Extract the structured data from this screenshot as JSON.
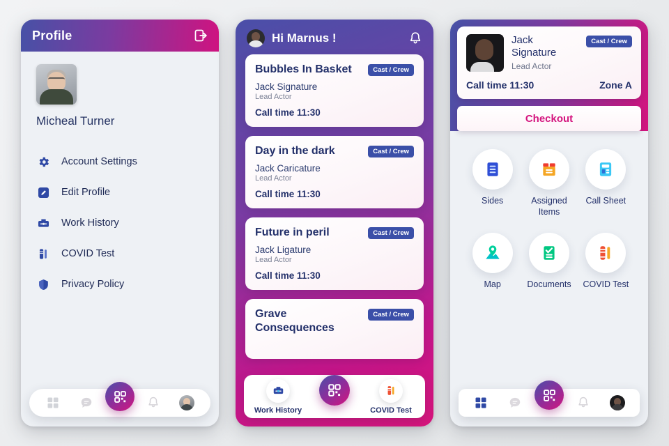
{
  "panel_profile": {
    "header": {
      "title": "Profile",
      "logout_icon": "logout-icon"
    },
    "user": {
      "name": "Micheal Turner",
      "avatar": "user-avatar"
    },
    "menu": [
      {
        "label": "Account Settings",
        "icon": "gear-icon"
      },
      {
        "label": "Edit Profile",
        "icon": "pencil-edit-icon"
      },
      {
        "label": "Work History",
        "icon": "briefcase-icon"
      },
      {
        "label": "COVID Test",
        "icon": "test-tube-icon"
      },
      {
        "label": "Privacy Policy",
        "icon": "shield-icon"
      }
    ],
    "nav": [
      {
        "icon": "grid-icon",
        "active": true
      },
      {
        "icon": "chat-icon",
        "active": false
      },
      {
        "icon": "qr-code-icon",
        "active": false
      },
      {
        "icon": "bell-icon",
        "active": false
      },
      {
        "icon": "profile-avatar-icon",
        "active": false
      }
    ]
  },
  "panel_home": {
    "greeting": "Hi Marnus !",
    "bell_icon": "bell-icon",
    "avatar": "user-avatar",
    "jobs": [
      {
        "title": "Bubbles In Basket",
        "badge": "Cast / Crew",
        "person": "Jack Signature",
        "role": "Lead Actor",
        "call_time": "Call time 11:30"
      },
      {
        "title": "Day in the dark",
        "badge": "Cast / Crew",
        "person": "Jack Caricature",
        "role": "Lead Actor",
        "call_time": "Call time 11:30"
      },
      {
        "title": "Future in peril",
        "badge": "Cast / Crew",
        "person": "Jack Ligature",
        "role": "Lead Actor",
        "call_time": "Call time 11:30"
      },
      {
        "title": "Grave Consequences",
        "badge": "Cast / Crew",
        "person": "",
        "role": "",
        "call_time": ""
      }
    ],
    "nav": [
      {
        "label": "Work History",
        "icon": "briefcase-icon"
      },
      {
        "label": "",
        "icon": "qr-code-icon"
      },
      {
        "label": "COVID Test",
        "icon": "test-tube-icon"
      }
    ]
  },
  "panel_detail": {
    "card": {
      "name": "Jack Signature",
      "role": "Lead Actor",
      "badge": "Cast / Crew",
      "call_time": "Call time 11:30",
      "zone": "Zone A",
      "avatar": "actor-avatar"
    },
    "checkout_label": "Checkout",
    "grid": [
      {
        "label": "Sides",
        "icon": "document-lines-icon",
        "color": "#2f4fd6"
      },
      {
        "label": "Assigned Items",
        "icon": "box-package-icon",
        "color": "#f5a623"
      },
      {
        "label": "Call Sheet",
        "icon": "call-sheet-icon",
        "color": "#3bc8f5"
      },
      {
        "label": "Map",
        "icon": "map-pin-icon",
        "color": "#00d09c"
      },
      {
        "label": "Documents",
        "icon": "checked-document-icon",
        "color": "#00c781"
      },
      {
        "label": "COVID Test",
        "icon": "test-tube-icon",
        "color": "#ef5134"
      }
    ],
    "nav": [
      {
        "icon": "grid-icon",
        "active": true
      },
      {
        "icon": "chat-icon",
        "active": false
      },
      {
        "icon": "qr-code-icon",
        "active": false
      },
      {
        "icon": "bell-icon",
        "active": false
      },
      {
        "icon": "profile-avatar-icon",
        "active": false
      }
    ]
  },
  "theme": {
    "gradient_start": "#4751a6",
    "gradient_mid": "#7b3ba0",
    "gradient_end": "#d4147e",
    "badge_blue": "#3b4fa8",
    "text_navy": "#23306a",
    "accent_pink": "#d4147e",
    "panel_bg": "#eef1f5"
  }
}
